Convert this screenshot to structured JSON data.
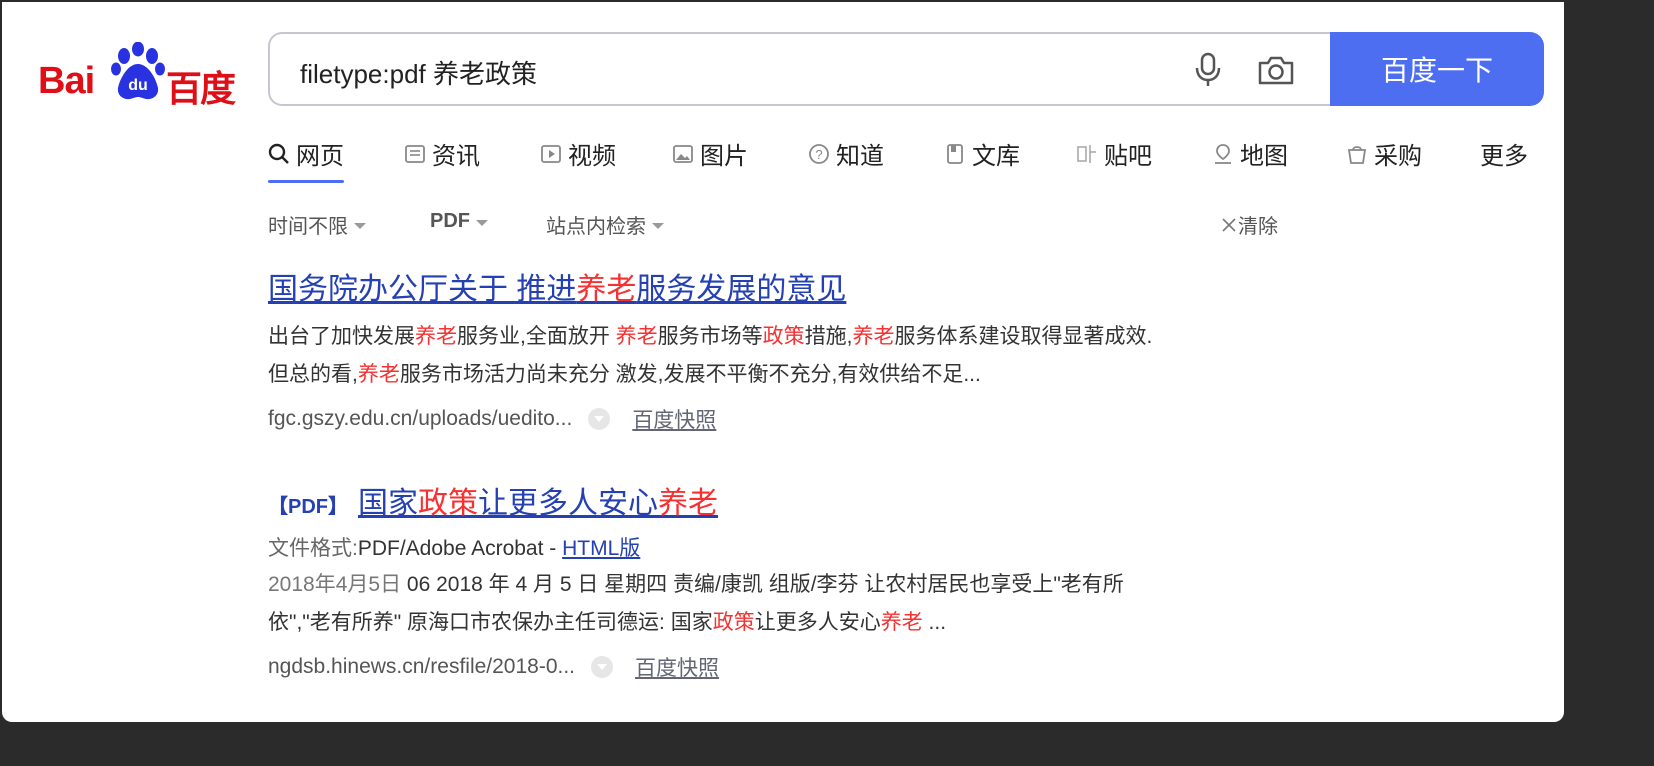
{
  "logo": {
    "left_text": "Bai",
    "paw_text": "du",
    "right_text": "百度"
  },
  "search": {
    "query": "filetype:pdf 养老政策",
    "button_label": "百度一下"
  },
  "tabs": [
    {
      "label": "网页",
      "icon": "search-icon"
    },
    {
      "label": "资讯",
      "icon": "news-icon"
    },
    {
      "label": "视频",
      "icon": "video-icon"
    },
    {
      "label": "图片",
      "icon": "image-icon"
    },
    {
      "label": "知道",
      "icon": "question-icon"
    },
    {
      "label": "文库",
      "icon": "document-icon"
    },
    {
      "label": "贴吧",
      "icon": "tieba-icon"
    },
    {
      "label": "地图",
      "icon": "map-icon"
    },
    {
      "label": "采购",
      "icon": "shopping-icon"
    },
    {
      "label": "更多",
      "icon": ""
    }
  ],
  "filters": {
    "time": "时间不限",
    "format": "PDF",
    "site": "站点内检索",
    "clear": "清除"
  },
  "results": [
    {
      "title_parts": [
        "国务院办公厅关于 推进",
        "养老",
        "服务发展的意见"
      ],
      "snippet_line1": [
        "出台了加快发展",
        "养老",
        "服务业,全面放开 ",
        "养老",
        "服务市场等",
        "政策",
        "措施,",
        "养老",
        "服务体系建设取得显著成效."
      ],
      "snippet_line2": [
        "但总的看,",
        "养老",
        "服务市场活力尚未充分 激发,发展不平衡不充分,有效供给不足..."
      ],
      "url": "fgc.gszy.edu.cn/uploads/uedito...",
      "snapshot": "百度快照"
    },
    {
      "badge": "【PDF】",
      "title_parts": [
        "国家",
        "政策",
        "让更多人安心",
        "养老"
      ],
      "format_label": "文件格式:",
      "format_value": "PDF/Adobe Acrobat - ",
      "format_link": "HTML版",
      "date": "2018年4月5日",
      "snippet_line1": " 06 2018 年 4 月 5 日 星期四 责编/康凯 组版/李芬 让农村居民也享受上\"老有所",
      "snippet_line2": [
        "依\",\"老有所养\" 原海口市农保办主任司德运: 国家",
        "政策",
        "让更多人安心",
        "养老",
        " ..."
      ],
      "url": "ngdsb.hinews.cn/resfile/2018-0...",
      "snapshot": "百度快照"
    }
  ],
  "colors": {
    "accent": "#4e6ef2",
    "highlight": "#f73131",
    "link": "#2440b3",
    "logo": "#de0f17"
  }
}
